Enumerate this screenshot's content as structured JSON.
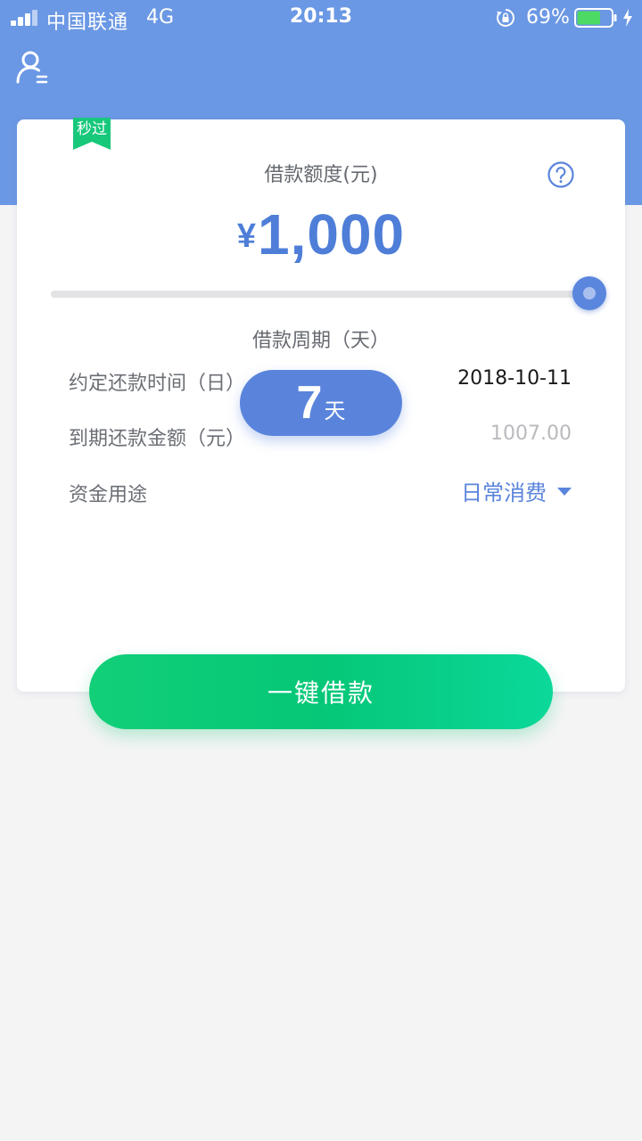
{
  "status_bar": {
    "carrier": "中国联通",
    "network": "4G",
    "time": "20:13",
    "battery_percent": "69%",
    "battery_level": 0.69,
    "signal_bars_active": 3,
    "icons": [
      "signal-icon",
      "rotation-lock-icon",
      "battery-icon",
      "charging-icon"
    ]
  },
  "header": {
    "user_icon": "user-profile-icon"
  },
  "card": {
    "badge": "秒过",
    "amount_label": "借款额度(元)",
    "currency": "¥",
    "amount": "1,000",
    "slider_value_fraction": 1.0,
    "help_icon": "help-question-icon",
    "period_label": "借款周期（天）",
    "period_value": "7",
    "period_unit": "天",
    "rows": {
      "repay_date_label": "约定还款时间（日）",
      "repay_date_value": "2018-10-11",
      "due_amount_label": "到期还款金额（元）",
      "due_amount_value": "1007.00",
      "purpose_label": "资金用途",
      "purpose_value": "日常消费"
    }
  },
  "action": {
    "loan_button": "一键借款"
  },
  "colors": {
    "header": "#6b98e4",
    "accent": "#5a84dc",
    "green": "#05c777",
    "background": "#f4f4f5"
  }
}
